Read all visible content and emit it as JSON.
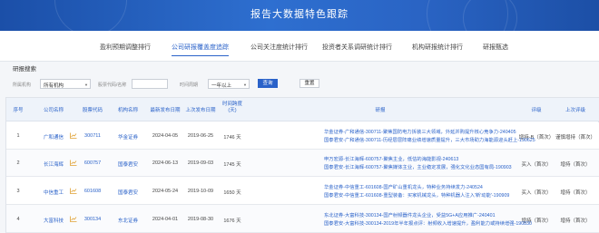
{
  "header": {
    "title": "报告大数据特色跟踪"
  },
  "tabs": [
    {
      "label": "盈利预期调整排行",
      "active": false
    },
    {
      "label": "公司研报覆盖度追踪",
      "active": true
    },
    {
      "label": "公司关注度统计排行",
      "active": false
    },
    {
      "label": "投资者关系调研统计排行",
      "active": false
    },
    {
      "label": "机构研报统计排行",
      "active": false
    },
    {
      "label": "研报甄选",
      "active": false
    }
  ],
  "section_title": "研报搜索",
  "filters": {
    "period_label": "所属机构",
    "period_value": "所有机构",
    "code_label": "股票代码/名称",
    "code_value": "",
    "time_label": "时间周期",
    "time_value": "一年以上",
    "query_button": "查询",
    "reset_button": "重置"
  },
  "table": {
    "headers": {
      "idx": "序号",
      "company": "公司名称",
      "code": "股票代码",
      "org": "机构名称",
      "latest_date": "最新发布日期",
      "prev_date": "上次发布日期",
      "interval": "时间跨度",
      "interval_unit": "(天)",
      "report": "研报",
      "rating": "评级",
      "last_rating": "上次评级"
    },
    "rows": [
      {
        "idx": "1",
        "company": "广和通信",
        "code": "300711",
        "org": "华金证券",
        "latest": "2024-04-05",
        "prev": "2019-06-25",
        "interval": "1746 天",
        "reports": [
          "华金证券-广和通信-300711-聚焦国防电力拆装三大领域，外延并购提升核心竞争力-240405",
          "国泰君安-广和通信-300711-历经层层阵痛业绩增速质量提升，三大市场助力海能源迎头赶上-190625"
        ],
        "rating": "增持-B（首次）",
        "last_rating": "谨慎增持（首次）"
      },
      {
        "idx": "2",
        "company": "长江海辉",
        "code": "600757",
        "org": "国泰君安",
        "latest": "2024-06-13",
        "prev": "2019-09-03",
        "interval": "1745 天",
        "reports": [
          "申万宏源-长江海辉-600757-聚焦主业，低估的海能影视-240613",
          "国泰君安-长江海辉-600757-聚焦媒体主业，主业稳定发展，强化文化业态国有局-190903"
        ],
        "rating": "买入（首次）",
        "last_rating": "增持（首次）"
      },
      {
        "idx": "3",
        "company": "中信重工",
        "code": "601608",
        "org": "国泰君安",
        "latest": "2024-05-24",
        "prev": "2019-10-09",
        "interval": "1650 天",
        "reports": [
          "华金证券-中信重工-601608-国产矿山重机龙头，特种业务持续发力-240524",
          "国泰君安-中信重工-601608-重型装备：买家机械龙头，特种机器人注入'新'动能'-190909"
        ],
        "rating": "买入（首次）",
        "last_rating": "增持（首次）"
      },
      {
        "idx": "4",
        "company": "大富科技",
        "code": "300134",
        "org": "东北证券",
        "latest": "2024-04-01",
        "prev": "2019-08-30",
        "interval": "1676 天",
        "reports": [
          "东北证券-大富科技-300134-国产射频器件龙头企业，受益5G+A应用推广-240401",
          "国泰君安-大富科技-300134-2019年半年报点评：射频收入增速提升，盈利能力或持续增强-190830"
        ],
        "rating": "增持（首次）",
        "last_rating": "增持（首次）"
      }
    ]
  },
  "colors": {
    "banner": "#2a64c4",
    "accent": "#2a62c9",
    "icon": "#e0a030"
  },
  "icons": {
    "chart": "trend-chart-icon",
    "dropdown": "chevron-down-icon"
  }
}
